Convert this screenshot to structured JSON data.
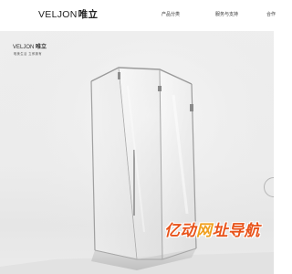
{
  "header": {
    "logo_latin": "VELJON",
    "logo_cn": "唯立",
    "nav": [
      {
        "label": "产品分类"
      },
      {
        "label": "服务与支持"
      },
      {
        "label": "合作"
      }
    ]
  },
  "hero": {
    "logo_latin": "VELJON",
    "logo_cn": "唯立",
    "tagline": "唯美生活 立即拥有",
    "door_label": "VELJON"
  },
  "watermark": {
    "part1": "亿动",
    "part2": "网",
    "part3": "址导航"
  },
  "colors": {
    "watermark_orange": "#ff6a13",
    "hero_background": "#ececec"
  }
}
